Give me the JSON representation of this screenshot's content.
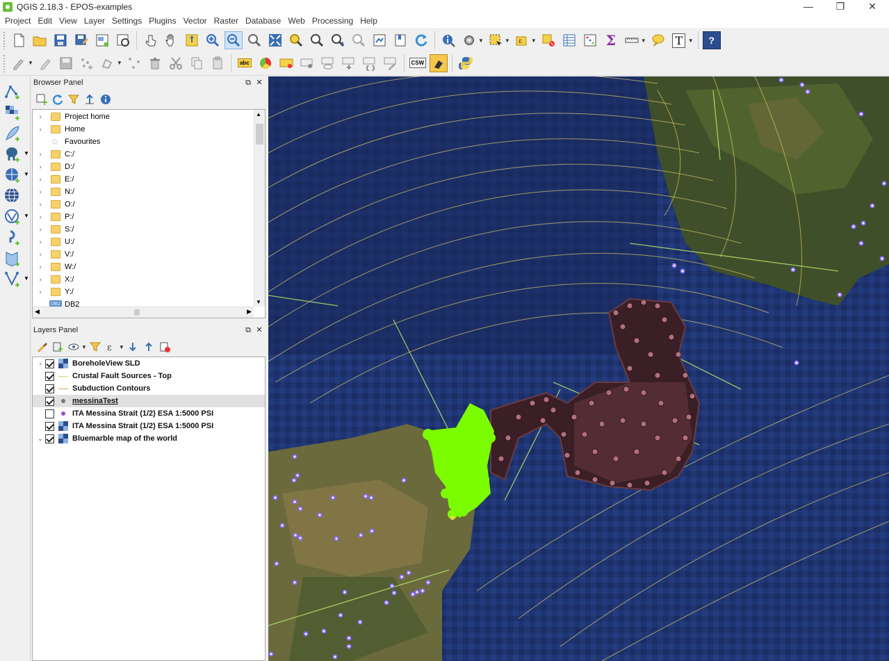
{
  "window": {
    "title": "QGIS 2.18.3 - EPOS-examples",
    "minimize_glyph": "—",
    "maximize_glyph": "❐",
    "close_glyph": "✕"
  },
  "menu": [
    "Project",
    "Edit",
    "View",
    "Layer",
    "Settings",
    "Plugins",
    "Vector",
    "Raster",
    "Database",
    "Web",
    "Processing",
    "Help"
  ],
  "toolbar_labels": {
    "label_tool_text": "abc",
    "csv_text": "CSW",
    "help_text": "?",
    "sigma_text": "Σ",
    "text_annotation": "T"
  },
  "browser_panel": {
    "title": "Browser Panel",
    "items": [
      {
        "label": "Project home",
        "icon": "folder-icon"
      },
      {
        "label": "Home",
        "icon": "folder-icon"
      },
      {
        "label": "Favourites",
        "icon": "star-icon"
      },
      {
        "label": "C:/",
        "icon": "folder-icon"
      },
      {
        "label": "D:/",
        "icon": "folder-icon"
      },
      {
        "label": "E:/",
        "icon": "folder-icon"
      },
      {
        "label": "N:/",
        "icon": "folder-icon"
      },
      {
        "label": "O:/",
        "icon": "folder-icon"
      },
      {
        "label": "P:/",
        "icon": "folder-icon"
      },
      {
        "label": "S:/",
        "icon": "folder-icon"
      },
      {
        "label": "U:/",
        "icon": "folder-icon"
      },
      {
        "label": "V:/",
        "icon": "folder-icon"
      },
      {
        "label": "W:/",
        "icon": "folder-icon"
      },
      {
        "label": "X:/",
        "icon": "folder-icon"
      },
      {
        "label": "Y:/",
        "icon": "folder-icon"
      },
      {
        "label": "DB2",
        "icon": "db2-icon"
      }
    ],
    "db2_badge": "DB2"
  },
  "layers_panel": {
    "title": "Layers Panel",
    "layers": [
      {
        "label": "BoreholeView SLD",
        "checked": true,
        "icon": "raster-icon",
        "expander": "›"
      },
      {
        "label": "Crustal Fault Sources - Top",
        "checked": true,
        "icon": "line-green-icon",
        "expander": ""
      },
      {
        "label": "Subduction Contours",
        "checked": true,
        "icon": "line-orange-icon",
        "expander": ""
      },
      {
        "label": "messinaTest",
        "checked": true,
        "icon": "point-grey-icon",
        "expander": "",
        "selected": true
      },
      {
        "label": "ITA Messina Strait (1/2) ESA 1:5000 PSI",
        "checked": false,
        "icon": "point-purple-icon",
        "expander": ""
      },
      {
        "label": "ITA Messina Strait (1/2) ESA 1:5000 PSI",
        "checked": true,
        "icon": "raster-icon",
        "expander": ""
      },
      {
        "label": "Bluemarble map of the world",
        "checked": true,
        "icon": "raster-icon",
        "expander": "⌄"
      }
    ]
  },
  "colors": {
    "accent_green": "#6bbf3a",
    "point_green": "#7cfc00",
    "point_pink": "#b0707a",
    "contour_yellow": "#d9c86a",
    "fault_green": "#b7e06a",
    "psi_marker": "#9f8cff"
  }
}
